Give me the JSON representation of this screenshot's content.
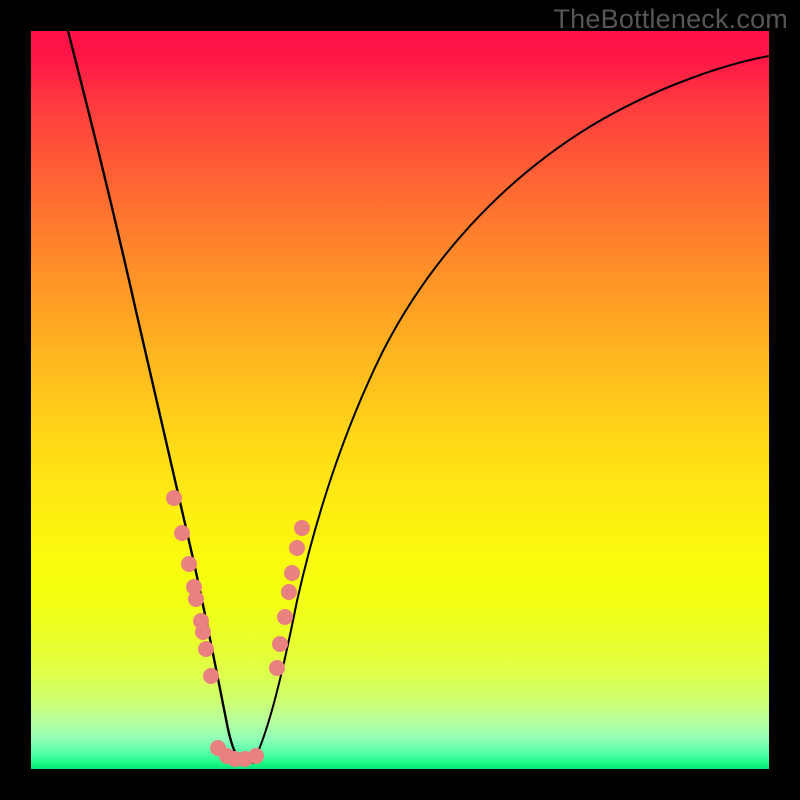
{
  "watermark": "TheBottleneck.com",
  "colors": {
    "background": "#000000",
    "dot": "#e98181",
    "curve": "#000000"
  },
  "chart_data": {
    "type": "line",
    "title": "",
    "xlabel": "",
    "ylabel": "",
    "xlim": [
      0,
      100
    ],
    "ylim": [
      0,
      100
    ],
    "notes": "Bottleneck-style V curve; no visible axes/tick labels; x=hardware balance index, y=bottleneck %. Minimum ~0 near x≈27. Salmon dots are sampled configurations along the curves.",
    "series": [
      {
        "name": "left-branch",
        "x": [
          5,
          8,
          10,
          12,
          14,
          16,
          18,
          19.5,
          21,
          22.3,
          23.5,
          24.5,
          25.7,
          27,
          28
        ],
        "values": [
          100,
          87,
          78,
          69,
          60,
          51,
          42,
          36,
          29.5,
          24,
          18.5,
          13,
          7,
          1.2,
          0.6
        ]
      },
      {
        "name": "right-branch",
        "x": [
          30,
          31.5,
          33,
          34,
          35,
          36,
          38,
          40,
          44,
          50,
          58,
          68,
          80,
          92,
          100
        ],
        "values": [
          0.6,
          4,
          12,
          18,
          24,
          29,
          36,
          41.5,
          50,
          59,
          67.5,
          75.5,
          82.5,
          88,
          91
        ]
      }
    ],
    "scatter": [
      {
        "name": "dots-left",
        "x": [
          19.3,
          20.5,
          21.4,
          22.1,
          22.4,
          23.0,
          23.3,
          23.7,
          24.4
        ],
        "values": [
          36.7,
          32.0,
          27.8,
          24.7,
          23.0,
          20.0,
          18.5,
          16.3,
          12.6
        ]
      },
      {
        "name": "dots-bottom",
        "x": [
          25.4,
          26.6,
          27.7,
          29.0,
          30.5
        ],
        "values": [
          2.9,
          1.8,
          1.4,
          1.4,
          1.7
        ]
      },
      {
        "name": "dots-right",
        "x": [
          33.3,
          33.8,
          34.4,
          35.0,
          35.4,
          36.1,
          36.7
        ],
        "values": [
          13.7,
          17.0,
          20.6,
          24.0,
          26.5,
          30.0,
          32.6
        ]
      }
    ]
  }
}
